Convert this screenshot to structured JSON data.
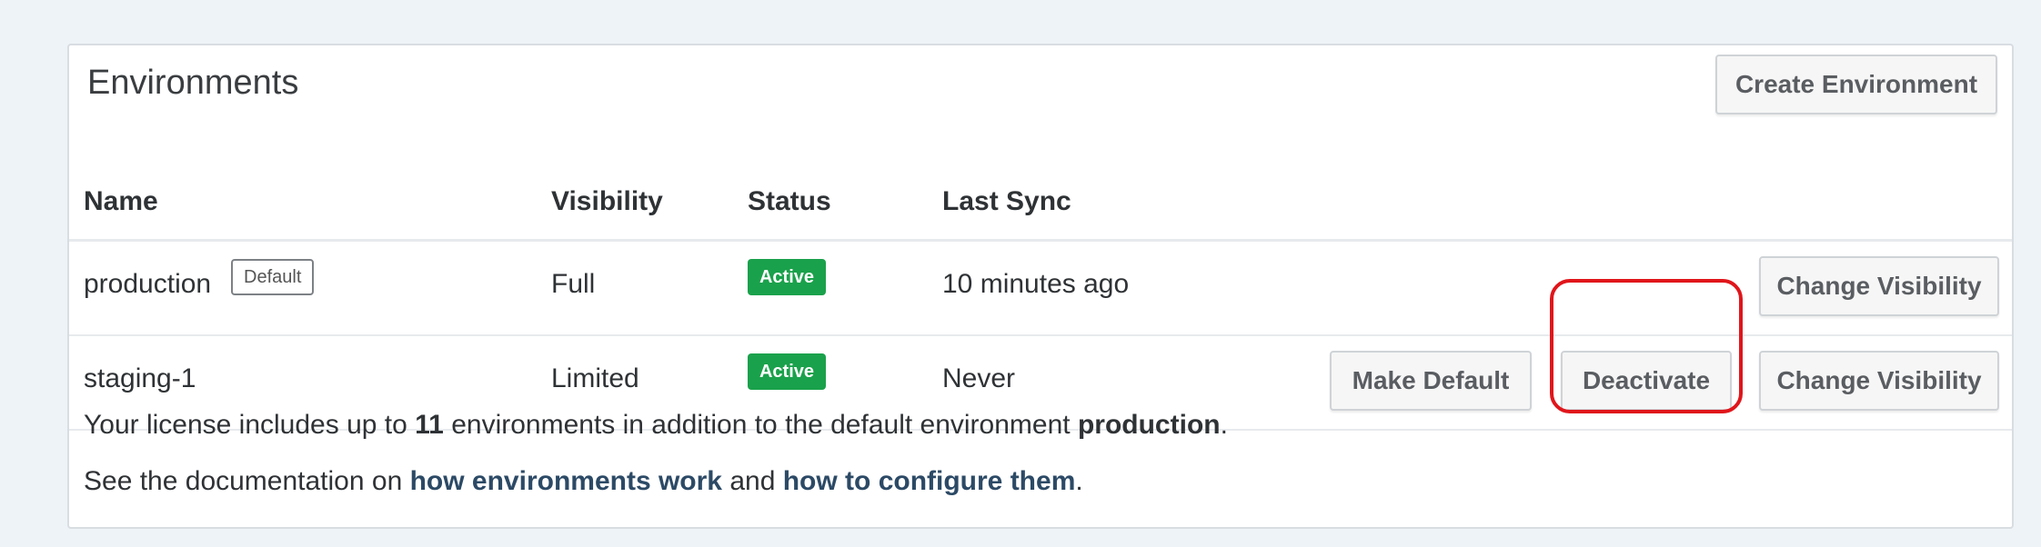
{
  "panel": {
    "title": "Environments",
    "create_button": "Create Environment"
  },
  "columns": {
    "name": "Name",
    "visibility": "Visibility",
    "status": "Status",
    "last_sync": "Last Sync"
  },
  "rows": [
    {
      "name": "production",
      "default_badge": "Default",
      "visibility": "Full",
      "status": "Active",
      "last_sync": "10 minutes ago",
      "change_visibility": "Change Visibility"
    },
    {
      "name": "staging-1",
      "visibility": "Limited",
      "status": "Active",
      "last_sync": "Never",
      "make_default": "Make Default",
      "deactivate": "Deactivate",
      "change_visibility": "Change Visibility"
    }
  ],
  "footer": {
    "license_pre": "Your license includes up to ",
    "license_count": "11",
    "license_mid": " environments in addition to the default environment ",
    "license_env": "production",
    "license_end": ".",
    "docs_pre": "See the documentation on ",
    "docs_link1": "how environments work",
    "docs_mid": " and ",
    "docs_link2": "how to configure them",
    "docs_end": "."
  },
  "colors": {
    "active_badge": "#1aa14b",
    "highlight": "#e0161b",
    "link": "#2c4a66"
  }
}
